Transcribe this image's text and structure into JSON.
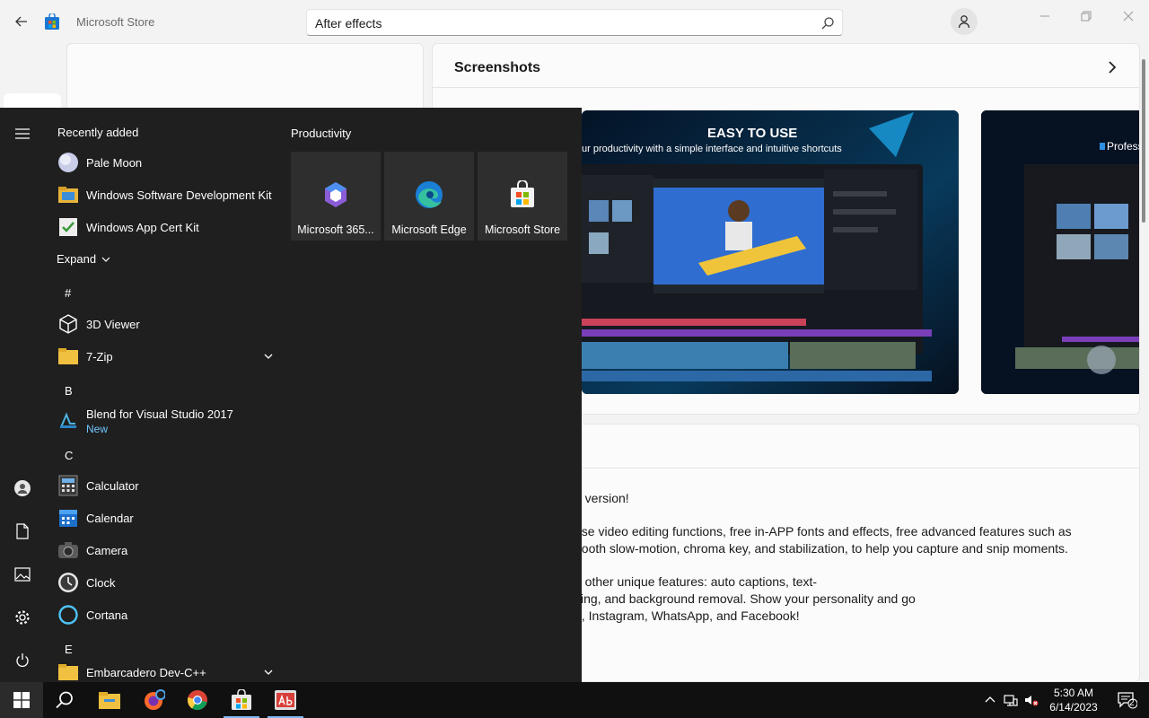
{
  "store": {
    "title": "Microsoft Store",
    "search_value": "After effects",
    "screenshots_title": "Screenshots",
    "shot1_heading": "EASY TO USE",
    "shot1_sub": "ur productivity with a simple interface and intuitive shortcuts",
    "shot2_heading": "Profess",
    "description_lines": [
      "o version!",
      "use video editing functions, free in-APP fonts and effects, free advanced features such as",
      "nooth slow-motion, chroma key, and stabilization, to help you capture and snip moments.",
      "h other unique features: auto captions, text-",
      "king, and background removal. Show your personality and go",
      "e, Instagram, WhatsApp, and Facebook!"
    ]
  },
  "start_menu": {
    "recent_header": "Recently added",
    "recent": [
      {
        "label": "Pale Moon"
      },
      {
        "label": "Windows Software Development Kit"
      },
      {
        "label": "Windows App Cert Kit"
      }
    ],
    "expand_label": "Expand",
    "groups": {
      "hash": "#",
      "b": "B",
      "c": "C",
      "e": "E"
    },
    "apps": {
      "viewer3d": "3D Viewer",
      "zip7": "7-Zip",
      "blend": "Blend for Visual Studio 2017",
      "blend_badge": "New",
      "calculator": "Calculator",
      "calendar": "Calendar",
      "camera": "Camera",
      "clock": "Clock",
      "cortana": "Cortana",
      "embarcadero": "Embarcadero Dev-C++"
    },
    "productivity_header": "Productivity",
    "tiles": [
      {
        "label": "Microsoft 365..."
      },
      {
        "label": "Microsoft Edge"
      },
      {
        "label": "Microsoft Store"
      }
    ]
  },
  "taskbar": {
    "time": "5:30 AM",
    "date": "6/14/2023",
    "notification_count": "2"
  },
  "colors": {
    "accent": "#0067c0",
    "start_bg": "#1f1f1f",
    "taskbar_bg": "#101010",
    "tile_bg": "#2e2e2e",
    "new_badge": "#6fc7ff"
  }
}
